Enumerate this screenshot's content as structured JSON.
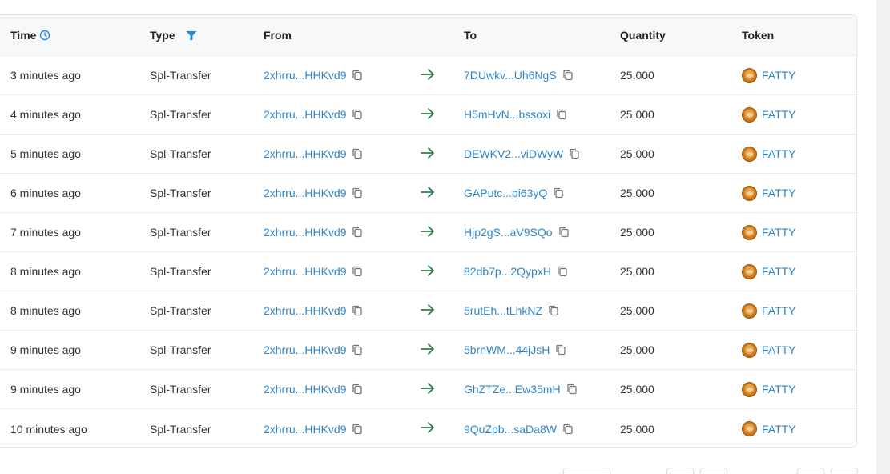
{
  "columns": {
    "time": "Time",
    "type": "Type",
    "from": "From",
    "to": "To",
    "quantity": "Quantity",
    "token": "Token"
  },
  "icons": {
    "time_header": "clock-icon",
    "type_header": "filter-icon",
    "copy": "copy-icon",
    "arrow": "arrow-right-icon",
    "token": "fatty-token-icon"
  },
  "colors": {
    "link": "#2f86c9",
    "arrow": "#2e7d4f",
    "filter": "#1e88e5"
  },
  "rows": [
    {
      "time": "3 minutes ago",
      "type": "Spl-Transfer",
      "from": "2xhrru...HHKvd9",
      "to": "7DUwkv...Uh6NgS",
      "quantity": "25,000",
      "token": "FATTY"
    },
    {
      "time": "4 minutes ago",
      "type": "Spl-Transfer",
      "from": "2xhrru...HHKvd9",
      "to": "H5mHvN...bssoxi",
      "quantity": "25,000",
      "token": "FATTY"
    },
    {
      "time": "5 minutes ago",
      "type": "Spl-Transfer",
      "from": "2xhrru...HHKvd9",
      "to": "DEWKV2...viDWyW",
      "quantity": "25,000",
      "token": "FATTY"
    },
    {
      "time": "6 minutes ago",
      "type": "Spl-Transfer",
      "from": "2xhrru...HHKvd9",
      "to": "GAPutc...pi63yQ",
      "quantity": "25,000",
      "token": "FATTY"
    },
    {
      "time": "7 minutes ago",
      "type": "Spl-Transfer",
      "from": "2xhrru...HHKvd9",
      "to": "Hjp2gS...aV9SQo",
      "quantity": "25,000",
      "token": "FATTY"
    },
    {
      "time": "8 minutes ago",
      "type": "Spl-Transfer",
      "from": "2xhrru...HHKvd9",
      "to": "82db7p...2QypxH",
      "quantity": "25,000",
      "token": "FATTY"
    },
    {
      "time": "8 minutes ago",
      "type": "Spl-Transfer",
      "from": "2xhrru...HHKvd9",
      "to": "5rutEh...tLhkNZ",
      "quantity": "25,000",
      "token": "FATTY"
    },
    {
      "time": "9 minutes ago",
      "type": "Spl-Transfer",
      "from": "2xhrru...HHKvd9",
      "to": "5brnWM...44jJsH",
      "quantity": "25,000",
      "token": "FATTY"
    },
    {
      "time": "9 minutes ago",
      "type": "Spl-Transfer",
      "from": "2xhrru...HHKvd9",
      "to": "GhZTZe...Ew35mH",
      "quantity": "25,000",
      "token": "FATTY"
    },
    {
      "time": "10 minutes ago",
      "type": "Spl-Transfer",
      "from": "2xhrru...HHKvd9",
      "to": "9QuZpb...saDa8W",
      "quantity": "25,000",
      "token": "FATTY"
    }
  ]
}
